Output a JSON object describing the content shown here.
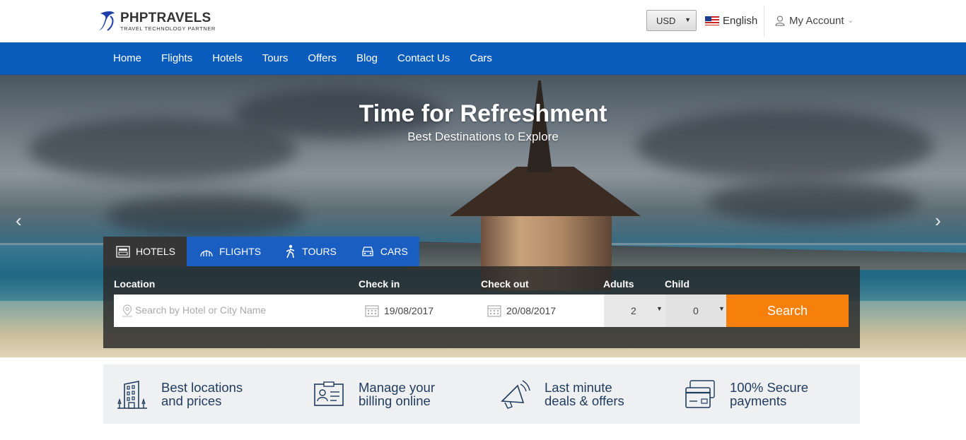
{
  "header": {
    "logo_name": "PHPTRAVELS",
    "logo_tagline": "TRAVEL TECHNOLOGY PARTNER",
    "currency": "USD",
    "language": "English",
    "account": "My Account"
  },
  "nav": {
    "items": [
      "Home",
      "Flights",
      "Hotels",
      "Tours",
      "Offers",
      "Blog",
      "Contact Us",
      "Cars"
    ]
  },
  "hero": {
    "title": "Time for Refreshment",
    "subtitle": "Best Destinations to Explore"
  },
  "search": {
    "tabs": [
      "HOTELS",
      "FLIGHTS",
      "TOURS",
      "CARS"
    ],
    "active_tab": "HOTELS",
    "labels": {
      "location": "Location",
      "checkin": "Check in",
      "checkout": "Check out",
      "adults": "Adults",
      "child": "Child"
    },
    "location_placeholder": "Search by Hotel or City Name",
    "checkin_value": "19/08/2017",
    "checkout_value": "20/08/2017",
    "adults_value": "2",
    "child_value": "0",
    "button": "Search"
  },
  "features": [
    {
      "line1": "Best locations",
      "line2": "and prices",
      "icon": "hotel-building-icon"
    },
    {
      "line1": "Manage your",
      "line2": "billing online",
      "icon": "id-card-icon"
    },
    {
      "line1": "Last minute",
      "line2": "deals & offers",
      "icon": "megaphone-icon"
    },
    {
      "line1": "100% Secure",
      "line2": "payments",
      "icon": "credit-card-icon"
    }
  ],
  "colors": {
    "nav_blue": "#0a5cbc",
    "search_orange": "#f7800c",
    "tab_blue": "#1b5ec2",
    "tab_active": "#363636"
  }
}
